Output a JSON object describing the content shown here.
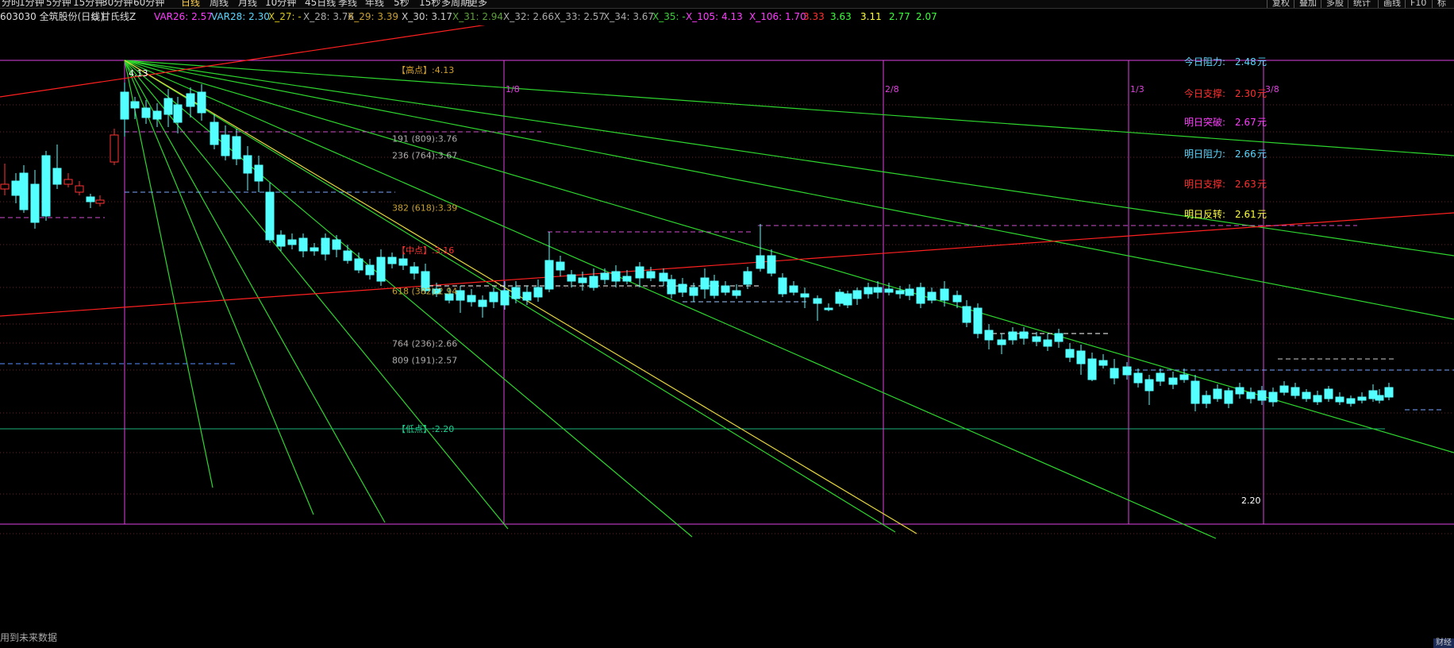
{
  "toolbar": {
    "periods": [
      {
        "label": "分时",
        "active": false
      },
      {
        "label": "1分钟",
        "active": false
      },
      {
        "label": "5分钟",
        "active": false
      },
      {
        "label": "15分钟",
        "active": false
      },
      {
        "label": "30分钟",
        "active": false
      },
      {
        "label": "60分钟",
        "active": false
      },
      {
        "label": "日线",
        "active": true
      },
      {
        "label": "周线",
        "active": false
      },
      {
        "label": "月线",
        "active": false
      },
      {
        "label": "10分钟",
        "active": false
      },
      {
        "label": "45日线",
        "active": false
      },
      {
        "label": "季线",
        "active": false
      },
      {
        "label": "年线",
        "active": false
      },
      {
        "label": "5秒",
        "active": false
      },
      {
        "label": "15秒",
        "active": false
      },
      {
        "label": "多周期",
        "active": false
      },
      {
        "label": "更多",
        "active": false
      }
    ],
    "right_buttons": [
      "复权",
      "叠加",
      "多股",
      "统计",
      "画线",
      "F10",
      "标"
    ]
  },
  "infobar": {
    "stock": "603030 全筑股份(日线)",
    "indicator": "甘氏线Z",
    "values": [
      {
        "text": "VAR26: 2.57",
        "color": "#ff3cff"
      },
      {
        "text": "VAR28: 2.30",
        "color": "#5ad7ff"
      },
      {
        "text": "X_27: -",
        "color": "#d9c81c"
      },
      {
        "text": "X_28: 3.76",
        "color": "#aaaaaa"
      },
      {
        "text": "X_29: 3.39",
        "color": "#c8a030"
      },
      {
        "text": "X_30: 3.17",
        "color": "#cccccc"
      },
      {
        "text": "X_31: 2.94",
        "color": "#5fa03c"
      },
      {
        "text": "X_32: 2.66",
        "color": "#aaaaaa"
      },
      {
        "text": "X_33: 2.57",
        "color": "#aaaaaa"
      },
      {
        "text": "X_34: 3.67",
        "color": "#aaaaaa"
      },
      {
        "text": "X_35: -",
        "color": "#3cd03c"
      },
      {
        "text": "X_105: 4.13",
        "color": "#ff3cff"
      },
      {
        "text": "X_106: 1.70",
        "color": "#ff3cff"
      },
      {
        "text": "3.33",
        "color": "#ff3030"
      },
      {
        "text": "3.63",
        "color": "#3cff3c"
      },
      {
        "text": "3.11",
        "color": "#ffff3c"
      },
      {
        "text": "2.77",
        "color": "#3cff3c"
      },
      {
        "text": "2.07",
        "color": "#3cff3c"
      }
    ]
  },
  "levels": [
    {
      "label": "【高点】:4.13",
      "price": 4.13
    },
    {
      "label": "191 (809):3.76",
      "price": 3.76
    },
    {
      "label": "236 (764):3.67",
      "price": 3.67
    },
    {
      "label": "382 (618):3.39",
      "price": 3.39
    },
    {
      "label": "【中点】:3.16",
      "price": 3.16
    },
    {
      "label": "618 (382):2.94",
      "price": 2.94
    },
    {
      "label": "764 (236):2.66",
      "price": 2.66
    },
    {
      "label": "809 (191):2.57",
      "price": 2.57
    },
    {
      "label": "【低点】:2.20",
      "price": 2.2
    }
  ],
  "forecast": [
    {
      "label": "今日阻力:",
      "value": "2.48",
      "unit": "元",
      "color": "#5ad7ff"
    },
    {
      "label": "今日支撑:",
      "value": "2.30",
      "unit": "元",
      "color": "#ff3030"
    },
    {
      "label": "明日突破:",
      "value": "2.67",
      "unit": "元",
      "color": "#ff3cff"
    },
    {
      "label": "明日阻力:",
      "value": "2.66",
      "unit": "元",
      "color": "#5ad7ff"
    },
    {
      "label": "明日支撑:",
      "value": "2.63",
      "unit": "元",
      "color": "#ff3030"
    },
    {
      "label": "明日反转:",
      "value": "2.61",
      "unit": "元",
      "color": "#ffff3c"
    }
  ],
  "dates": [
    "1/8",
    "2/8",
    "1/3",
    "3/8"
  ],
  "high_marker": "4.13",
  "low_marker": "2.20",
  "colors": {
    "up": "#ff3232",
    "down": "#54ffff",
    "frame": "#e040e0",
    "fan": "#2ed62e",
    "fan_main": "#e6d640",
    "trend": "#ff2020"
  },
  "status": {
    "text": "用到未来数据",
    "corner": "财经"
  }
}
